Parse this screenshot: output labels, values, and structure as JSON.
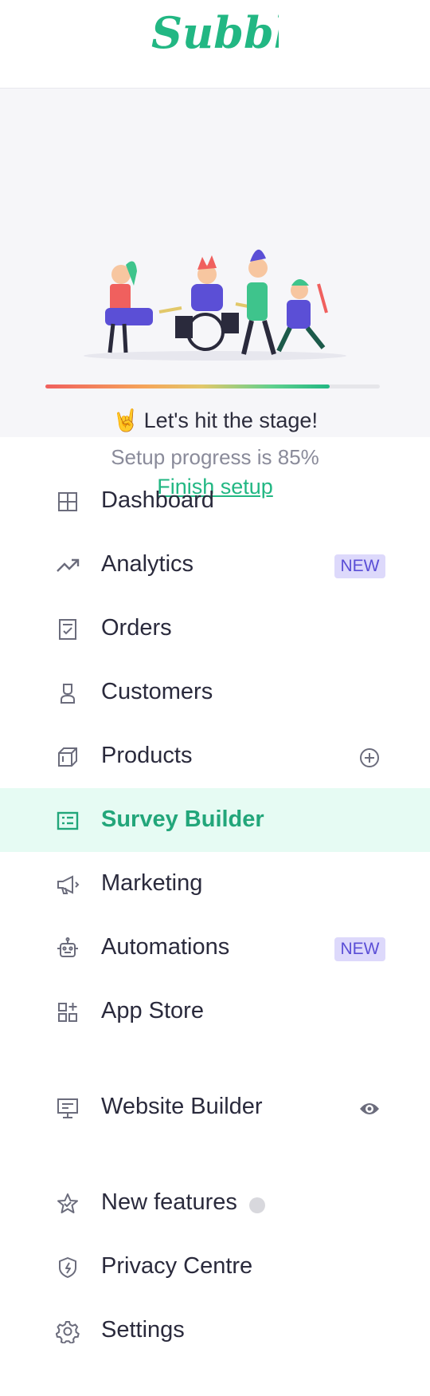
{
  "brand": {
    "logo_text": "Subbly",
    "color": "#22b783"
  },
  "setup": {
    "title_emoji": "🤘",
    "title": "Let's hit the stage!",
    "progress_text": "Setup progress is 85%",
    "progress_value": 0.85,
    "link": "Finish setup"
  },
  "nav": {
    "items": [
      {
        "label": "Dashboard",
        "icon": "dashboard-icon"
      },
      {
        "label": "Analytics",
        "icon": "trending-up-icon",
        "badge": "NEW"
      },
      {
        "label": "Orders",
        "icon": "orders-icon"
      },
      {
        "label": "Customers",
        "icon": "customer-icon"
      },
      {
        "label": "Products",
        "icon": "box-icon"
      },
      {
        "label": "Survey Builder",
        "icon": "survey-icon",
        "active": true
      },
      {
        "label": "Marketing",
        "icon": "megaphone-icon"
      },
      {
        "label": "Automations",
        "icon": "robot-icon",
        "badge": "NEW"
      },
      {
        "label": "App Store",
        "icon": "apps-icon"
      },
      {
        "label": "Website Builder",
        "icon": "monitor-icon"
      },
      {
        "label": "New features",
        "icon": "star-icon"
      },
      {
        "label": "Privacy Centre",
        "icon": "shield-icon"
      },
      {
        "label": "Settings",
        "icon": "gear-icon"
      }
    ]
  },
  "colors": {
    "active_bg": "#e6fbf3",
    "active_text": "#22a67a",
    "badge_bg": "#ddd9fb",
    "badge_text": "#5a4ed6"
  }
}
